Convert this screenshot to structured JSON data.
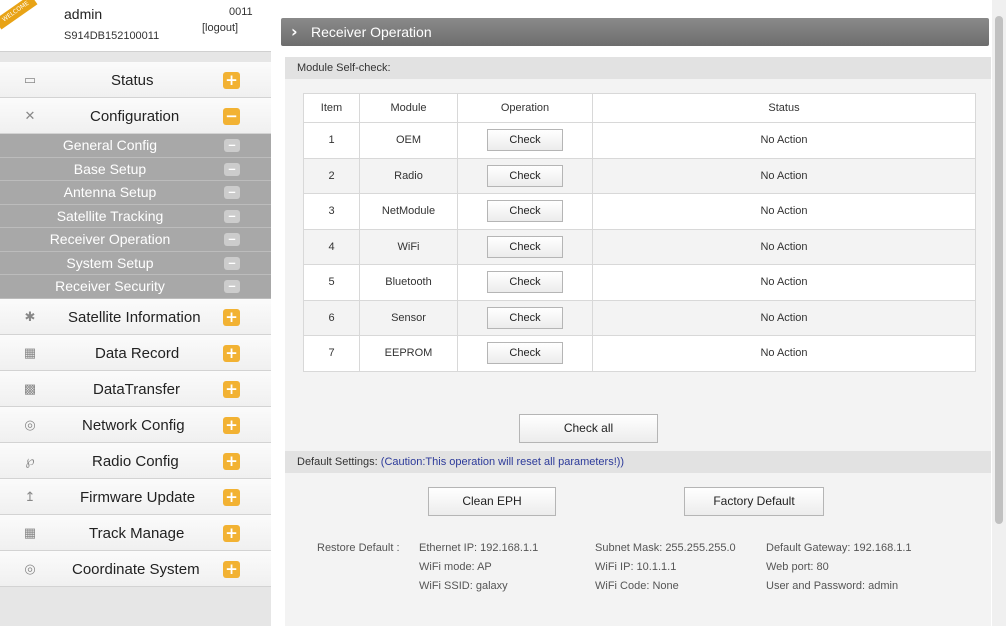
{
  "user": {
    "ribbon": "WELCOME",
    "name": "admin",
    "serial": "S914DB152100011",
    "code": "0011",
    "logout": "[logout]"
  },
  "menu": [
    {
      "label": "Status",
      "icon": "monitor-icon",
      "btn": "+"
    },
    {
      "label": "Configuration",
      "icon": "tools-icon",
      "btn": "−"
    }
  ],
  "submenu": [
    "General Config",
    "Base Setup",
    "Antenna Setup",
    "Satellite Tracking",
    "Receiver Operation",
    "System Setup",
    "Receiver Security"
  ],
  "menu2": [
    {
      "label": "Satellite Information",
      "icon": "satellite-icon",
      "btn": "+"
    },
    {
      "label": "Data Record",
      "icon": "calendar-icon",
      "btn": "+"
    },
    {
      "label": "DataTransfer",
      "icon": "network-icon",
      "btn": "+"
    },
    {
      "label": "Network Config",
      "icon": "globe-icon",
      "btn": "+"
    },
    {
      "label": "Radio Config",
      "icon": "antenna-icon",
      "btn": "+"
    },
    {
      "label": "Firmware Update",
      "icon": "upload-icon",
      "btn": "+"
    },
    {
      "label": "Track Manage",
      "icon": "calendar-icon",
      "btn": "+"
    },
    {
      "label": "Coordinate System",
      "icon": "globe-icon",
      "btn": "+"
    }
  ],
  "page": {
    "title": "Receiver Operation",
    "self_check_header": "Module Self-check:",
    "columns": [
      "Item",
      "Module",
      "Operation",
      "Status"
    ],
    "rows": [
      {
        "item": "1",
        "module": "OEM",
        "op": "Check",
        "status": "No Action"
      },
      {
        "item": "2",
        "module": "Radio",
        "op": "Check",
        "status": "No Action"
      },
      {
        "item": "3",
        "module": "NetModule",
        "op": "Check",
        "status": "No Action"
      },
      {
        "item": "4",
        "module": "WiFi",
        "op": "Check",
        "status": "No Action"
      },
      {
        "item": "5",
        "module": "Bluetooth",
        "op": "Check",
        "status": "No Action"
      },
      {
        "item": "6",
        "module": "Sensor",
        "op": "Check",
        "status": "No Action"
      },
      {
        "item": "7",
        "module": "EEPROM",
        "op": "Check",
        "status": "No Action"
      }
    ],
    "check_all": "Check all",
    "default_header": "Default Settings:",
    "caution": "(Caution:This operation will reset all parameters!))",
    "clean_eph": "Clean EPH",
    "factory_default": "Factory Default",
    "restore_label": "Restore Default :",
    "defaults": {
      "eth_ip": "Ethernet IP: 192.168.1.1",
      "subnet": "Subnet Mask: 255.255.255.0",
      "gateway": "Default Gateway: 192.168.1.1",
      "wifi_mode": "WiFi mode: AP",
      "wifi_ip": "WiFi IP: 10.1.1.1",
      "web_port": "Web port: 80",
      "wifi_ssid": "WiFi SSID: galaxy",
      "wifi_code": "WiFi Code: None",
      "user_pass": "User and Password: admin"
    }
  }
}
